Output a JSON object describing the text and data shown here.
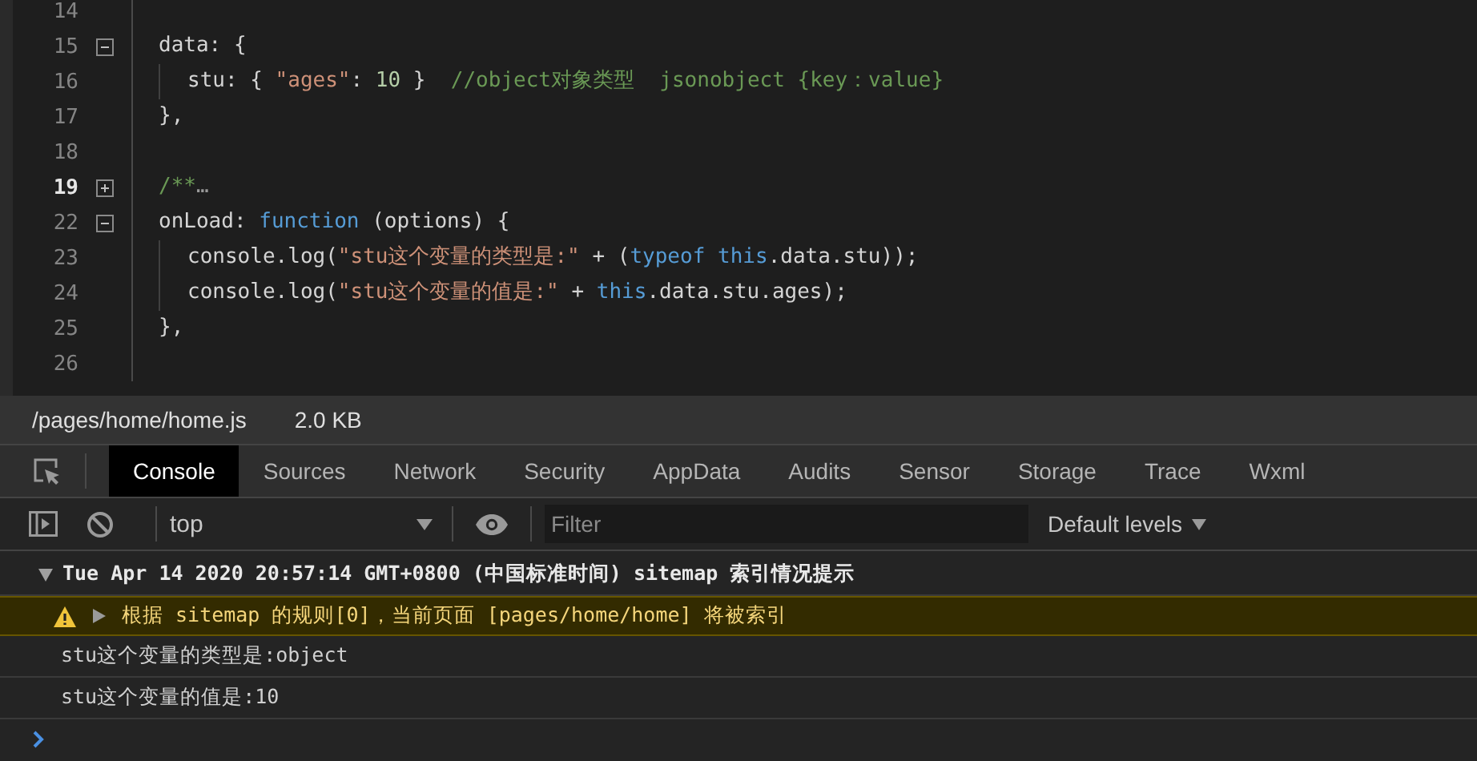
{
  "editor": {
    "lines": [
      {
        "number": "14",
        "active": false,
        "collapsible": false
      },
      {
        "number": "15",
        "active": false,
        "collapsible": true,
        "folded": false,
        "tokens": [
          {
            "kind": "plain",
            "text": "data: {"
          }
        ],
        "children": [
          {
            "number": "16",
            "active": false,
            "collapsible": false,
            "tokens": [
              {
                "kind": "plain",
                "text": "stu: { "
              },
              {
                "kind": "string",
                "text": "\"ages\""
              },
              {
                "kind": "plain",
                "text": ": "
              },
              {
                "kind": "number",
                "text": "10"
              },
              {
                "kind": "plain",
                "text": " }  "
              },
              {
                "kind": "comment",
                "text": "//object对象类型  jsonobject {key：value}"
              }
            ]
          }
        ]
      },
      {
        "number": "17",
        "active": false,
        "collapsible": false,
        "tokens": [
          {
            "kind": "plain",
            "text": "},"
          }
        ]
      },
      {
        "number": "18",
        "active": false,
        "collapsible": false
      },
      {
        "number": "19",
        "active": true,
        "collapsible": true,
        "folded": true,
        "tokens": [
          {
            "kind": "comment",
            "text": "/**"
          },
          {
            "kind": "ellipsis",
            "text": "…"
          }
        ]
      },
      {
        "number": "22",
        "active": false,
        "collapsible": true,
        "folded": false,
        "tokens": [
          {
            "kind": "plain",
            "text": "onLoad: "
          },
          {
            "kind": "keyword",
            "text": "function"
          },
          {
            "kind": "plain",
            "text": " (options) {"
          }
        ],
        "children": [
          {
            "number": "23",
            "active": false,
            "collapsible": false,
            "tokens": [
              {
                "kind": "plain",
                "text": "console.log("
              },
              {
                "kind": "string",
                "text": "\"stu这个变量的类型是:\""
              },
              {
                "kind": "plain",
                "text": " + ("
              },
              {
                "kind": "keyword",
                "text": "typeof"
              },
              {
                "kind": "keyword",
                "text": " this"
              },
              {
                "kind": "plain",
                "text": ".data.stu));"
              }
            ]
          },
          {
            "number": "24",
            "active": false,
            "collapsible": false,
            "tokens": [
              {
                "kind": "plain",
                "text": "console.log("
              },
              {
                "kind": "string",
                "text": "\"stu这个变量的值是:\""
              },
              {
                "kind": "plain",
                "text": " + "
              },
              {
                "kind": "keyword",
                "text": "this"
              },
              {
                "kind": "plain",
                "text": ".data.stu.ages);"
              }
            ]
          }
        ]
      },
      {
        "number": "25",
        "active": false,
        "collapsible": false,
        "tokens": [
          {
            "kind": "plain",
            "text": "},"
          }
        ]
      },
      {
        "number": "26",
        "active": false,
        "collapsible": false
      }
    ]
  },
  "file_bar": {
    "path": "/pages/home/home.js",
    "size": "2.0 KB"
  },
  "devtools": {
    "tabs": [
      {
        "label": "Console",
        "selected": true
      },
      {
        "label": "Sources",
        "selected": false
      },
      {
        "label": "Network",
        "selected": false
      },
      {
        "label": "Security",
        "selected": false
      },
      {
        "label": "AppData",
        "selected": false
      },
      {
        "label": "Audits",
        "selected": false
      },
      {
        "label": "Sensor",
        "selected": false
      },
      {
        "label": "Storage",
        "selected": false
      },
      {
        "label": "Trace",
        "selected": false
      },
      {
        "label": "Wxml",
        "selected": false
      }
    ],
    "toolbar": {
      "context": "top",
      "filter_placeholder": "Filter",
      "levels": "Default levels"
    },
    "console": {
      "messages": [
        {
          "kind": "group",
          "expanded": true,
          "text": "Tue Apr 14 2020 20:57:14 GMT+0800 (中国标准时间) sitemap 索引情况提示"
        },
        {
          "kind": "warning",
          "expanded": false,
          "text": "根据 sitemap 的规则[0]，当前页面 [pages/home/home] 将被索引"
        },
        {
          "kind": "log",
          "text": "stu这个变量的类型是:object"
        },
        {
          "kind": "log",
          "text": "stu这个变量的值是:10"
        }
      ]
    }
  }
}
